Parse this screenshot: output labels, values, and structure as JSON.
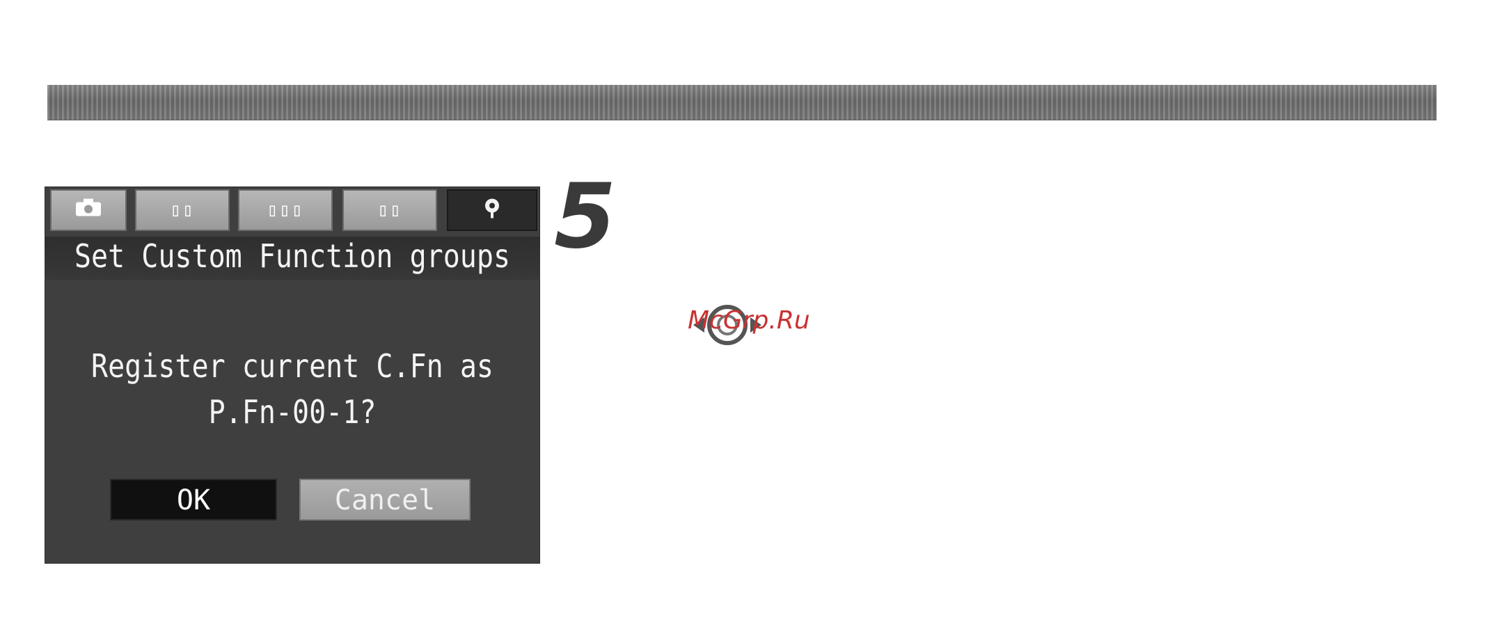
{
  "menu_tabs": [
    {
      "name": "shooting-tab",
      "icon": "camera-icon",
      "glyph": ""
    },
    {
      "name": "playback-tab-1",
      "icon": "playback-icon",
      "glyph": "▯▯"
    },
    {
      "name": "setup-tab-1",
      "icon": "setup-icon",
      "glyph": "▯▯▯"
    },
    {
      "name": "setup-tab-2",
      "icon": "setup-icon",
      "glyph": "▯▯"
    },
    {
      "name": "custom-function-tab",
      "icon": "custom-function-icon",
      "glyph": "",
      "active": true
    }
  ],
  "dialog": {
    "title": "Set Custom Function groups",
    "message_line_1": "Register current C.Fn as",
    "message_line_2": "P.Fn-00-1?",
    "ok_label": "OK",
    "cancel_label": "Cancel",
    "selected_button": "OK"
  },
  "step_number": "5",
  "dial_icon": "quick-control-dial-icon",
  "watermark": "McGrp.Ru",
  "colors": {
    "lcd_background": "#3f3f3f",
    "selected_button": "#101010",
    "unselected_button": "#a6a6a6",
    "watermark": "#c83232"
  }
}
